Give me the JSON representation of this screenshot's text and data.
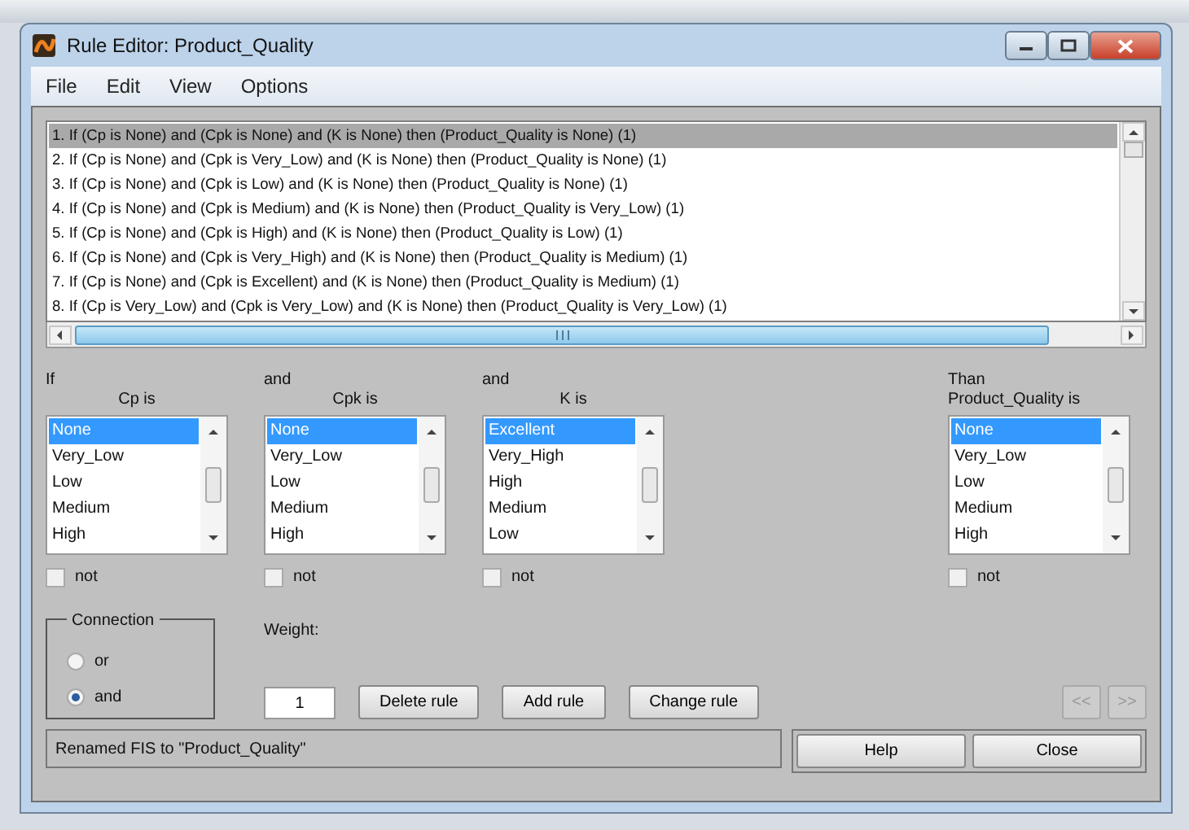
{
  "window": {
    "title": "Rule Editor: Product_Quality"
  },
  "menu": [
    "File",
    "Edit",
    "View",
    "Options"
  ],
  "rules": [
    {
      "text": "1. If (Cp is None) and (Cpk is None) and (K is None) then (Product_Quality is None) (1)",
      "selected": true
    },
    {
      "text": "2. If (Cp is None) and (Cpk is Very_Low) and (K is None) then (Product_Quality is None) (1)",
      "selected": false
    },
    {
      "text": "3. If (Cp is None) and (Cpk is Low) and (K is None) then (Product_Quality is None) (1)",
      "selected": false
    },
    {
      "text": "4. If (Cp is None) and (Cpk is Medium) and (K is None) then (Product_Quality is Very_Low) (1)",
      "selected": false
    },
    {
      "text": "5. If (Cp is None) and (Cpk is High) and (K is None) then (Product_Quality is Low) (1)",
      "selected": false
    },
    {
      "text": "6. If (Cp is None) and (Cpk is Very_High) and (K is None) then (Product_Quality is Medium) (1)",
      "selected": false
    },
    {
      "text": "7. If (Cp is None) and (Cpk is Excellent) and (K is None) then (Product_Quality is Medium) (1)",
      "selected": false
    },
    {
      "text": "8. If (Cp is Very_Low) and (Cpk is Very_Low) and (K is None) then (Product_Quality is Very_Low) (1)",
      "selected": false
    }
  ],
  "variables": [
    {
      "kind": "input",
      "connector": "If",
      "label": "Cp is",
      "items": [
        {
          "text": "None",
          "selected": true
        },
        {
          "text": "Very_Low",
          "selected": false
        },
        {
          "text": "Low",
          "selected": false
        },
        {
          "text": "Medium",
          "selected": false
        },
        {
          "text": "High",
          "selected": false
        }
      ],
      "not_label": "not",
      "not_checked": false
    },
    {
      "kind": "input",
      "connector": "and",
      "label": "Cpk is",
      "items": [
        {
          "text": "None",
          "selected": true
        },
        {
          "text": "Very_Low",
          "selected": false
        },
        {
          "text": "Low",
          "selected": false
        },
        {
          "text": "Medium",
          "selected": false
        },
        {
          "text": "High",
          "selected": false
        }
      ],
      "not_label": "not",
      "not_checked": false
    },
    {
      "kind": "input",
      "connector": "and",
      "label": "K is",
      "items": [
        {
          "text": "Excellent",
          "selected": true
        },
        {
          "text": "Very_High",
          "selected": false
        },
        {
          "text": "High",
          "selected": false
        },
        {
          "text": "Medium",
          "selected": false
        },
        {
          "text": "Low",
          "selected": false
        }
      ],
      "not_label": "not",
      "not_checked": false
    },
    {
      "kind": "output",
      "connector": "Than",
      "label": "Product_Quality is",
      "items": [
        {
          "text": "None",
          "selected": true
        },
        {
          "text": "Very_Low",
          "selected": false
        },
        {
          "text": "Low",
          "selected": false
        },
        {
          "text": "Medium",
          "selected": false
        },
        {
          "text": "High",
          "selected": false
        }
      ],
      "not_label": "not",
      "not_checked": false
    }
  ],
  "connection": {
    "title": "Connection",
    "options": [
      {
        "label": "or",
        "selected": false
      },
      {
        "label": "and",
        "selected": true
      }
    ]
  },
  "weight": {
    "label": "Weight:",
    "value": "1"
  },
  "buttons": [
    {
      "label": "Delete rule",
      "disabled": false
    },
    {
      "label": "Add rule",
      "disabled": false
    },
    {
      "label": "Change rule",
      "disabled": false
    }
  ],
  "nav_buttons": [
    {
      "label": "<<",
      "disabled": true
    },
    {
      "label": ">>",
      "disabled": true
    }
  ],
  "status_bar": {
    "text": "Renamed FIS to \"Product_Quality\""
  },
  "footer_buttons": [
    {
      "label": "Help"
    },
    {
      "label": "Close"
    }
  ]
}
